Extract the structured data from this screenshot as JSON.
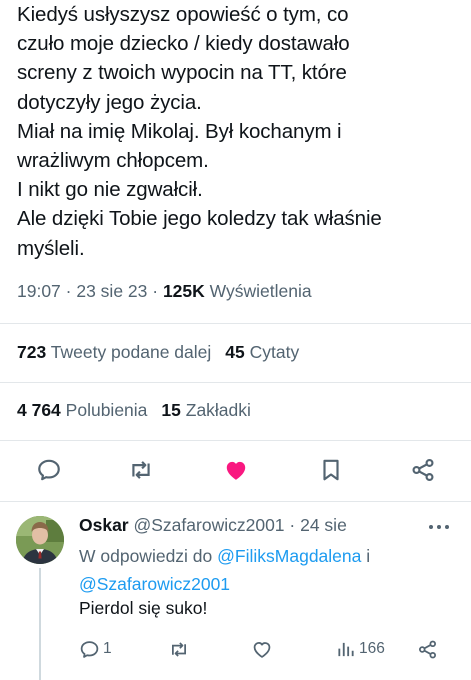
{
  "tweet": {
    "lines": [
      "Kiedyś usłyszysz opowieść o tym, co",
      "czuło moje dziecko / kiedy dostawało",
      "screny z twoich wypocin na TT, które",
      "dotyczyły jego życia.",
      "Miał na imię Mikolaj. Był kochanym i",
      "wrażliwym chłopcem.",
      "I nikt go nie zgwałcił.",
      "Ale dzięki Tobie jego koledzy tak właśnie",
      "myśleli."
    ],
    "time": "19:07",
    "sep": " · ",
    "date": "23 sie 23",
    "views_count": "125K",
    "views_label": "Wyświetlenia",
    "retweets_count": "723",
    "retweets_label": "Tweety podane dalej",
    "quotes_count": "45",
    "quotes_label": "Cytaty",
    "likes_count": "4 764",
    "likes_label": "Polubienia",
    "bookmarks_count": "15",
    "bookmarks_label": "Zakładki"
  },
  "actions": {
    "reply_icon": "reply-icon",
    "retweet_icon": "retweet-icon",
    "like_icon": "heart-filled-icon",
    "bookmark_icon": "bookmark-icon",
    "share_icon": "share-icon",
    "like_color": "#f91880",
    "icon_color": "#536471"
  },
  "reply": {
    "name": "Oskar",
    "handle": "@Szafarowicz2001",
    "sep": " · ",
    "date": "24 sie",
    "reply_prefix": "W odpowiedzi do",
    "mention1": "@FiliksMagdalena",
    "mention_join": "i",
    "mention2": "@Szafarowicz2001",
    "text": "Pierdol się suko!",
    "reply_count": "1",
    "views_count": "166"
  },
  "colors": {
    "text": "#0f1419",
    "muted": "#536471",
    "link": "#1d9bf0",
    "divider": "#e3e7ea"
  }
}
